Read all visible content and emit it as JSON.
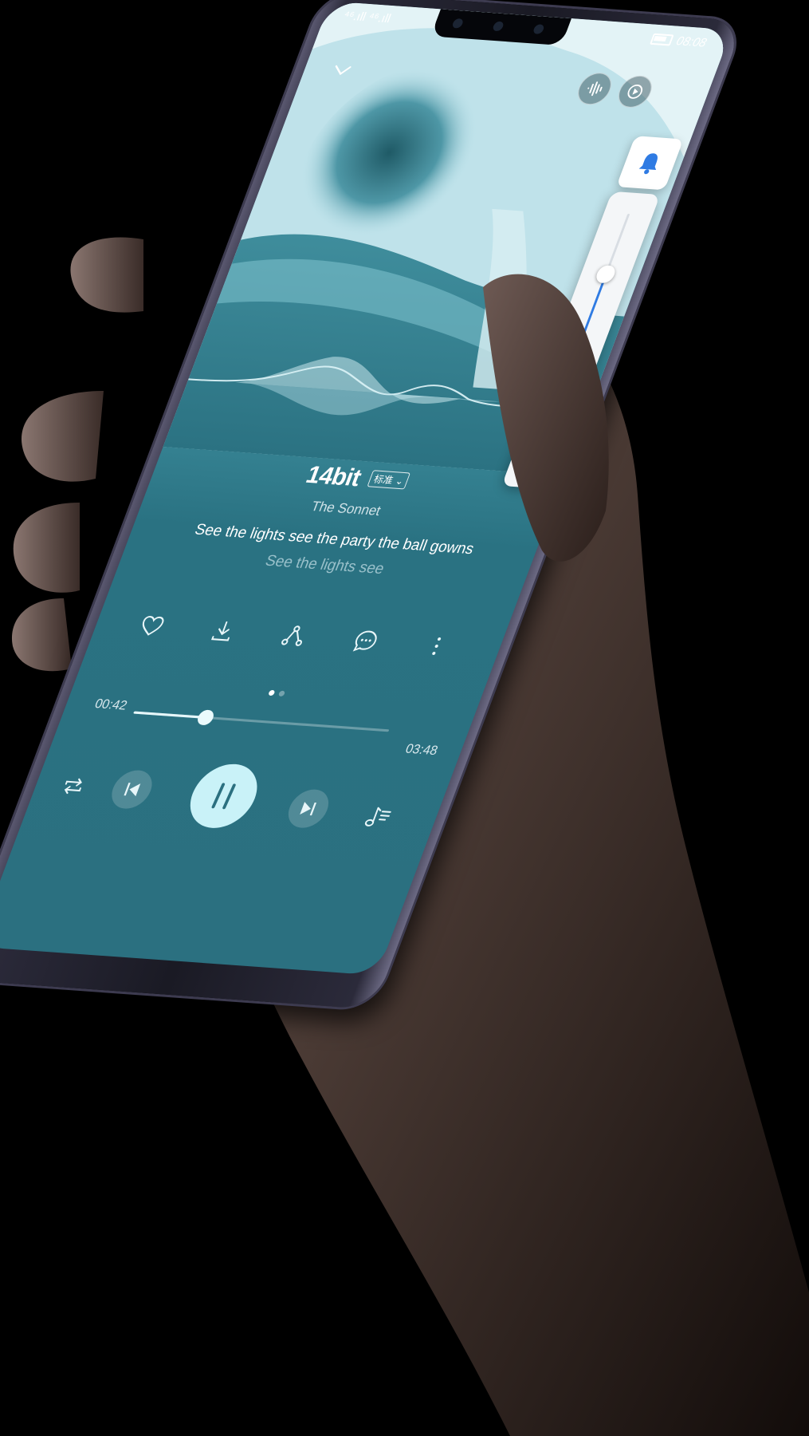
{
  "status_bar": {
    "signal_text": "⁴⁶.ıll ⁴⁶.ıll",
    "time": "08:08"
  },
  "volume_panel": {
    "level": 0.62,
    "accent_color": "#2f7be3",
    "icons": [
      "bell-icon",
      "music-note-icon",
      "gear-icon"
    ]
  },
  "player": {
    "audio_quality": "14bit",
    "quality_select": "标准",
    "artist": "The Sonnet",
    "lyric_current": "See the lights see the party the ball gowns",
    "lyric_next": "See the lights see",
    "actions": [
      "heart-icon",
      "download-icon",
      "share-icon",
      "comment-icon",
      "more-icon"
    ],
    "page_indicator": {
      "count": 2,
      "active": 0
    },
    "elapsed": "00:42",
    "duration": "03:48",
    "progress": 0.28,
    "controls": [
      "repeat-icon",
      "previous-icon",
      "pause-icon",
      "next-icon",
      "playlist-icon"
    ]
  },
  "colors": {
    "screen_accent": "#2a7282",
    "play_button": "#c9f2f8"
  }
}
